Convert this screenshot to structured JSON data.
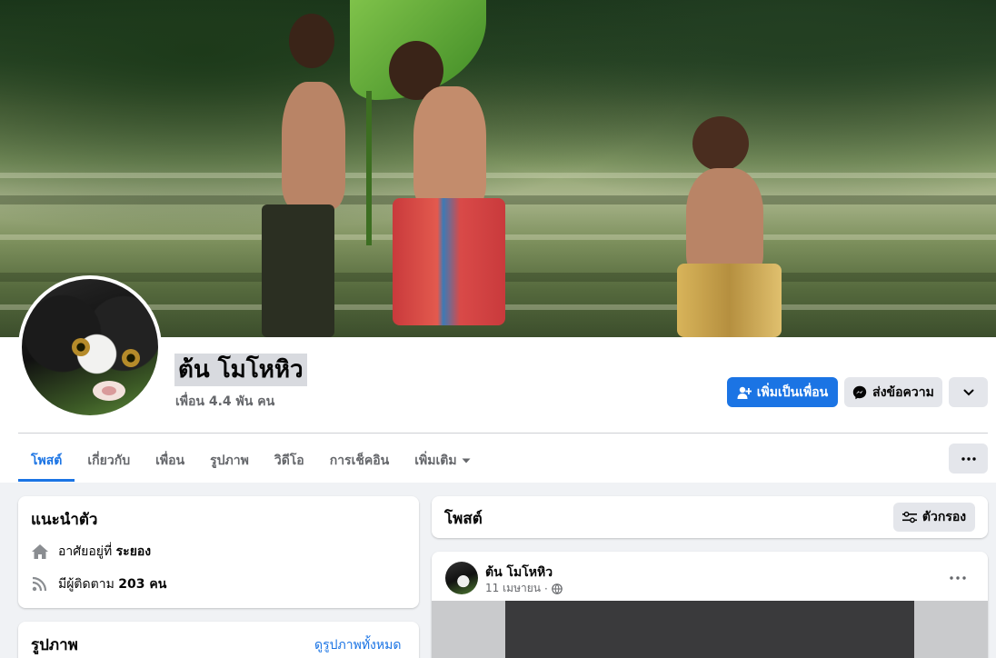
{
  "profile": {
    "name": "ต้น โมโหหิว",
    "friends": "เพื่อน 4.4 พัน คน"
  },
  "actions": {
    "add_friend": "เพิ่มเป็นเพื่อน",
    "message": "ส่งข้อความ"
  },
  "tabs": [
    {
      "label": "โพสต์",
      "active": true
    },
    {
      "label": "เกี่ยวกับ"
    },
    {
      "label": "เพื่อน"
    },
    {
      "label": "รูปภาพ"
    },
    {
      "label": "วิดีโอ"
    },
    {
      "label": "การเช็คอิน"
    },
    {
      "label": "เพิ่มเติม"
    }
  ],
  "intro": {
    "title": "แนะนำตัว",
    "lives_in_prefix": "อาศัยอยู่ที่ ",
    "lives_in_place": "ระยอง",
    "followers_prefix": "มีผู้ติดตาม ",
    "followers_count": "203 คน"
  },
  "photos": {
    "title": "รูปภาพ",
    "see_all": "ดูรูปภาพทั้งหมด"
  },
  "posts": {
    "title": "โพสต์",
    "filter": "ตัวกรอง"
  },
  "post": {
    "author": "ต้น โมโหหิว",
    "date": "11 เมษายน"
  },
  "colors": {
    "accent": "#1b74e4",
    "surface": "#ffffff",
    "background": "#f0f2f5"
  }
}
